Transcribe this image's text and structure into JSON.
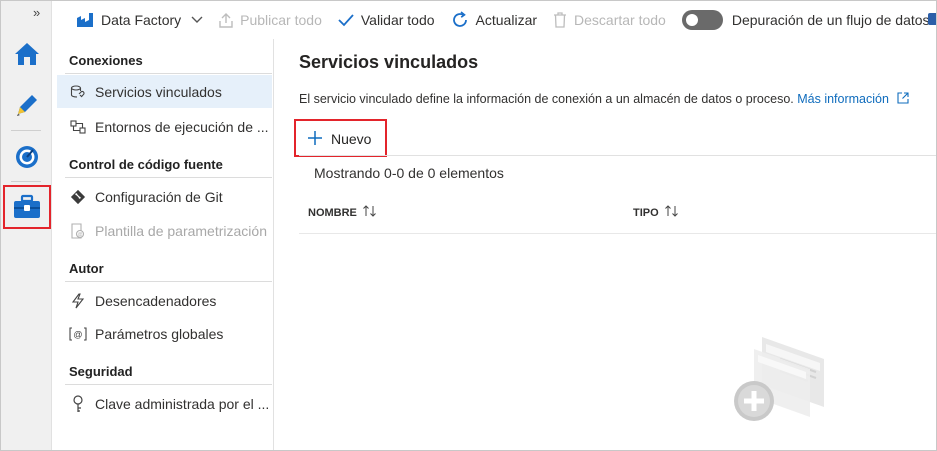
{
  "rail": {
    "collapse_label": "»",
    "items": [
      {
        "name": "home",
        "icon": "home-icon"
      },
      {
        "name": "author",
        "icon": "pencil-icon"
      },
      {
        "name": "monitor",
        "icon": "gauge-icon"
      },
      {
        "name": "manage",
        "icon": "toolbox-icon"
      }
    ]
  },
  "topbar": {
    "factory": "Data Factory",
    "publish_all": "Publicar todo",
    "validate_all": "Validar todo",
    "refresh": "Actualizar",
    "discard_all": "Descartar todo",
    "debug_label": "Depuración de un flujo de datos"
  },
  "nav": {
    "sections": {
      "connections": "Conexiones",
      "source_control": "Control de código fuente",
      "author": "Autor",
      "security": "Seguridad"
    },
    "items": {
      "linked_services": "Servicios vinculados",
      "integration_runtimes": "Entornos de ejecución de ...",
      "git_config": "Configuración de Git",
      "param_template": "Plantilla de parametrización",
      "triggers": "Desencadenadores",
      "global_params": "Parámetros globales",
      "managed_key": "Clave administrada por el ..."
    }
  },
  "main": {
    "title": "Servicios vinculados",
    "description": "El servicio vinculado define la información de conexión a un almacén de datos o proceso.",
    "more_info": "Más información",
    "new_button": "Nuevo",
    "showing": "Mostrando 0-0 de 0 elementos",
    "columns": [
      "NOMBRE",
      "TIPO"
    ]
  },
  "colors": {
    "accent": "#0f6cbd",
    "highlight_border": "#e3242b",
    "selected_bg": "#e6f0fa"
  }
}
